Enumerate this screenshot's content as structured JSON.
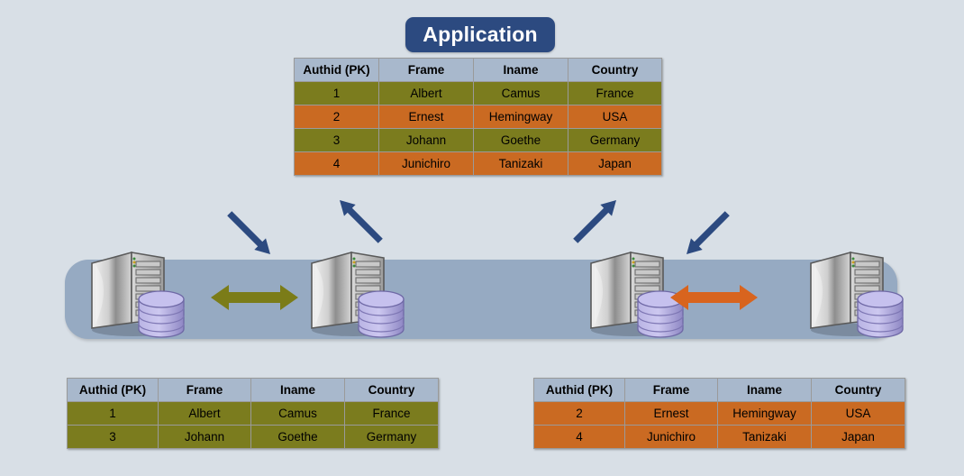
{
  "diagram": {
    "title_badge": "Application",
    "background_color": "#d8dfe6",
    "band_color": "#96aac2",
    "badge_color": "#2c4a80",
    "header_color": "#a8b8cc",
    "green_color": "#7b7c1e",
    "orange_color": "#ca6a22",
    "olive_arrow_color": "#7b7c18",
    "orange_arrow_color": "#d8641e",
    "blue_arrow_color": "#2c4a80"
  },
  "columns": [
    "Authid (PK)",
    "Frame",
    "Iname",
    "Country"
  ],
  "master_table": {
    "name": "application-table",
    "rows": [
      {
        "authid": "1",
        "frame": "Albert",
        "iname": "Camus",
        "country": "France",
        "shard": "green"
      },
      {
        "authid": "2",
        "frame": "Ernest",
        "iname": "Hemingway",
        "country": "USA",
        "shard": "orange"
      },
      {
        "authid": "3",
        "frame": "Johann",
        "iname": "Goethe",
        "country": "Germany",
        "shard": "green"
      },
      {
        "authid": "4",
        "frame": "Junichiro",
        "iname": "Tanizaki",
        "country": "Japan",
        "shard": "orange"
      }
    ]
  },
  "left_table": {
    "name": "shard-green-table",
    "rows": [
      {
        "authid": "1",
        "frame": "Albert",
        "iname": "Camus",
        "country": "France",
        "shard": "green"
      },
      {
        "authid": "3",
        "frame": "Johann",
        "iname": "Goethe",
        "country": "Germany",
        "shard": "green"
      }
    ]
  },
  "right_table": {
    "name": "shard-orange-table",
    "rows": [
      {
        "authid": "2",
        "frame": "Ernest",
        "iname": "Hemingway",
        "country": "USA",
        "shard": "orange"
      },
      {
        "authid": "4",
        "frame": "Junichiro",
        "iname": "Tanizaki",
        "country": "Japan",
        "shard": "orange"
      }
    ]
  },
  "nodes": [
    {
      "id": "node-1",
      "label": "database-server-node-1"
    },
    {
      "id": "node-2",
      "label": "database-server-node-2"
    },
    {
      "id": "node-3",
      "label": "database-server-node-3"
    },
    {
      "id": "node-4",
      "label": "database-server-node-4"
    }
  ],
  "connectors": [
    {
      "name": "app-to-node2-link",
      "kind": "bidirectional-diagonal",
      "color": "#2c4a80"
    },
    {
      "name": "app-to-node3-link",
      "kind": "bidirectional-diagonal",
      "color": "#2c4a80"
    },
    {
      "name": "green-replication-link",
      "kind": "bidirectional-horizontal",
      "color": "#7b7c18"
    },
    {
      "name": "orange-replication-link",
      "kind": "bidirectional-horizontal",
      "color": "#d8641e"
    }
  ]
}
